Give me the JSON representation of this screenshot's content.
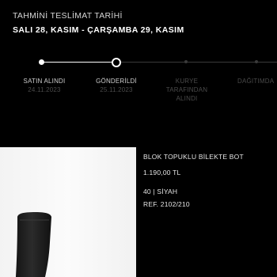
{
  "delivery": {
    "estimate_label": "TAHMİNİ TESLİMAT TARİHİ",
    "estimate_dates": "SALI 28, KASIM - ÇARŞAMBA 29, KASIM"
  },
  "tracking": {
    "current_step_index": 1,
    "steps": [
      {
        "label": "SATIN ALINDI",
        "date": "24.11.2023",
        "state": "done"
      },
      {
        "label": "GÖNDERİLDİ",
        "date": "25.11.2023",
        "state": "current"
      },
      {
        "label": "KURYE TARAFINDAN ALINDI",
        "date": "",
        "state": "pending"
      },
      {
        "label": "DAĞITIMDA",
        "date": "",
        "state": "pending"
      }
    ]
  },
  "product": {
    "name": "BLOK TOPUKLU BİLEKTE BOT",
    "price": "1.190,00 TL",
    "size_color": "40 | SİYAH",
    "reference": "REF. 2102/210"
  },
  "colors": {
    "background": "#000000",
    "active": "#ffffff",
    "inactive": "#3a3a3a"
  }
}
